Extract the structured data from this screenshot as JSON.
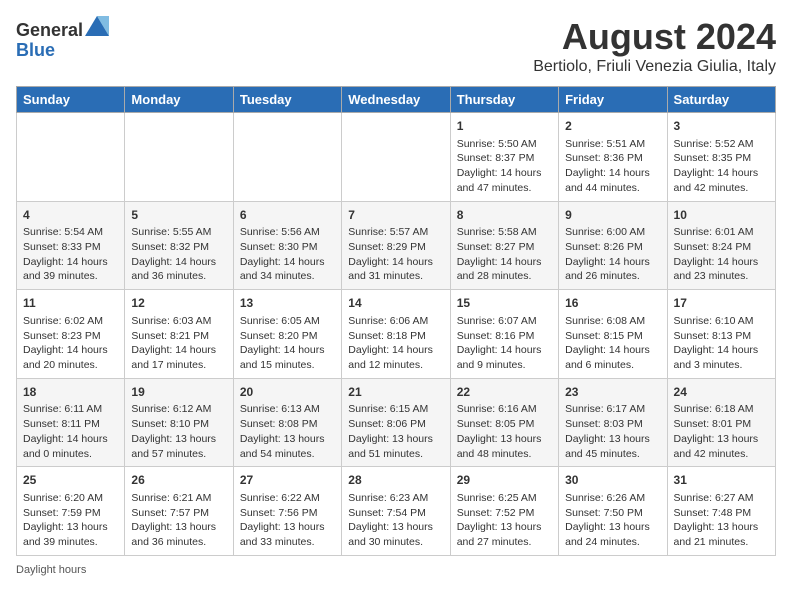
{
  "header": {
    "logo_general": "General",
    "logo_blue": "Blue",
    "main_title": "August 2024",
    "subtitle": "Bertiolo, Friuli Venezia Giulia, Italy"
  },
  "calendar": {
    "days_of_week": [
      "Sunday",
      "Monday",
      "Tuesday",
      "Wednesday",
      "Thursday",
      "Friday",
      "Saturday"
    ],
    "weeks": [
      [
        {
          "day": "",
          "info": ""
        },
        {
          "day": "",
          "info": ""
        },
        {
          "day": "",
          "info": ""
        },
        {
          "day": "",
          "info": ""
        },
        {
          "day": "1",
          "info": "Sunrise: 5:50 AM\nSunset: 8:37 PM\nDaylight: 14 hours and 47 minutes."
        },
        {
          "day": "2",
          "info": "Sunrise: 5:51 AM\nSunset: 8:36 PM\nDaylight: 14 hours and 44 minutes."
        },
        {
          "day": "3",
          "info": "Sunrise: 5:52 AM\nSunset: 8:35 PM\nDaylight: 14 hours and 42 minutes."
        }
      ],
      [
        {
          "day": "4",
          "info": "Sunrise: 5:54 AM\nSunset: 8:33 PM\nDaylight: 14 hours and 39 minutes."
        },
        {
          "day": "5",
          "info": "Sunrise: 5:55 AM\nSunset: 8:32 PM\nDaylight: 14 hours and 36 minutes."
        },
        {
          "day": "6",
          "info": "Sunrise: 5:56 AM\nSunset: 8:30 PM\nDaylight: 14 hours and 34 minutes."
        },
        {
          "day": "7",
          "info": "Sunrise: 5:57 AM\nSunset: 8:29 PM\nDaylight: 14 hours and 31 minutes."
        },
        {
          "day": "8",
          "info": "Sunrise: 5:58 AM\nSunset: 8:27 PM\nDaylight: 14 hours and 28 minutes."
        },
        {
          "day": "9",
          "info": "Sunrise: 6:00 AM\nSunset: 8:26 PM\nDaylight: 14 hours and 26 minutes."
        },
        {
          "day": "10",
          "info": "Sunrise: 6:01 AM\nSunset: 8:24 PM\nDaylight: 14 hours and 23 minutes."
        }
      ],
      [
        {
          "day": "11",
          "info": "Sunrise: 6:02 AM\nSunset: 8:23 PM\nDaylight: 14 hours and 20 minutes."
        },
        {
          "day": "12",
          "info": "Sunrise: 6:03 AM\nSunset: 8:21 PM\nDaylight: 14 hours and 17 minutes."
        },
        {
          "day": "13",
          "info": "Sunrise: 6:05 AM\nSunset: 8:20 PM\nDaylight: 14 hours and 15 minutes."
        },
        {
          "day": "14",
          "info": "Sunrise: 6:06 AM\nSunset: 8:18 PM\nDaylight: 14 hours and 12 minutes."
        },
        {
          "day": "15",
          "info": "Sunrise: 6:07 AM\nSunset: 8:16 PM\nDaylight: 14 hours and 9 minutes."
        },
        {
          "day": "16",
          "info": "Sunrise: 6:08 AM\nSunset: 8:15 PM\nDaylight: 14 hours and 6 minutes."
        },
        {
          "day": "17",
          "info": "Sunrise: 6:10 AM\nSunset: 8:13 PM\nDaylight: 14 hours and 3 minutes."
        }
      ],
      [
        {
          "day": "18",
          "info": "Sunrise: 6:11 AM\nSunset: 8:11 PM\nDaylight: 14 hours and 0 minutes."
        },
        {
          "day": "19",
          "info": "Sunrise: 6:12 AM\nSunset: 8:10 PM\nDaylight: 13 hours and 57 minutes."
        },
        {
          "day": "20",
          "info": "Sunrise: 6:13 AM\nSunset: 8:08 PM\nDaylight: 13 hours and 54 minutes."
        },
        {
          "day": "21",
          "info": "Sunrise: 6:15 AM\nSunset: 8:06 PM\nDaylight: 13 hours and 51 minutes."
        },
        {
          "day": "22",
          "info": "Sunrise: 6:16 AM\nSunset: 8:05 PM\nDaylight: 13 hours and 48 minutes."
        },
        {
          "day": "23",
          "info": "Sunrise: 6:17 AM\nSunset: 8:03 PM\nDaylight: 13 hours and 45 minutes."
        },
        {
          "day": "24",
          "info": "Sunrise: 6:18 AM\nSunset: 8:01 PM\nDaylight: 13 hours and 42 minutes."
        }
      ],
      [
        {
          "day": "25",
          "info": "Sunrise: 6:20 AM\nSunset: 7:59 PM\nDaylight: 13 hours and 39 minutes."
        },
        {
          "day": "26",
          "info": "Sunrise: 6:21 AM\nSunset: 7:57 PM\nDaylight: 13 hours and 36 minutes."
        },
        {
          "day": "27",
          "info": "Sunrise: 6:22 AM\nSunset: 7:56 PM\nDaylight: 13 hours and 33 minutes."
        },
        {
          "day": "28",
          "info": "Sunrise: 6:23 AM\nSunset: 7:54 PM\nDaylight: 13 hours and 30 minutes."
        },
        {
          "day": "29",
          "info": "Sunrise: 6:25 AM\nSunset: 7:52 PM\nDaylight: 13 hours and 27 minutes."
        },
        {
          "day": "30",
          "info": "Sunrise: 6:26 AM\nSunset: 7:50 PM\nDaylight: 13 hours and 24 minutes."
        },
        {
          "day": "31",
          "info": "Sunrise: 6:27 AM\nSunset: 7:48 PM\nDaylight: 13 hours and 21 minutes."
        }
      ]
    ]
  },
  "footer": {
    "label": "Daylight hours"
  }
}
